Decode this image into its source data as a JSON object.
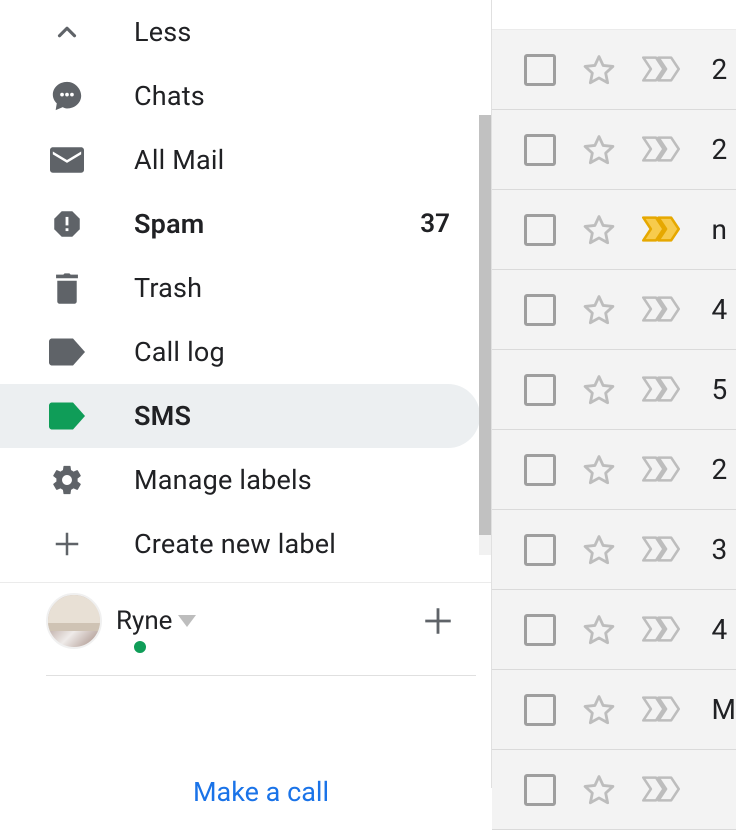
{
  "sidebar": {
    "items": [
      {
        "id": "less",
        "label": "Less",
        "icon": "chevron-up",
        "bold": false,
        "count": null
      },
      {
        "id": "chats",
        "label": "Chats",
        "icon": "chat",
        "bold": false,
        "count": null
      },
      {
        "id": "allmail",
        "label": "All Mail",
        "icon": "mail",
        "bold": false,
        "count": null
      },
      {
        "id": "spam",
        "label": "Spam",
        "icon": "spam",
        "bold": true,
        "count": "37"
      },
      {
        "id": "trash",
        "label": "Trash",
        "icon": "trash",
        "bold": false,
        "count": null
      },
      {
        "id": "calllog",
        "label": "Call log",
        "icon": "label-gray",
        "bold": false,
        "count": null
      },
      {
        "id": "sms",
        "label": "SMS",
        "icon": "label-green",
        "bold": true,
        "selected": true,
        "count": null
      },
      {
        "id": "manage",
        "label": "Manage labels",
        "icon": "gear",
        "bold": false,
        "count": null
      },
      {
        "id": "create",
        "label": "Create new label",
        "icon": "plus",
        "bold": false,
        "count": null
      }
    ]
  },
  "hangouts": {
    "user_name": "Ryne",
    "make_call": "Make a call"
  },
  "mail": {
    "rows": [
      {
        "sender": "2",
        "important": false
      },
      {
        "sender": "2",
        "important": false
      },
      {
        "sender": "n",
        "important": true
      },
      {
        "sender": "4",
        "important": false
      },
      {
        "sender": "5",
        "important": false
      },
      {
        "sender": "2",
        "important": false
      },
      {
        "sender": "3",
        "important": false
      },
      {
        "sender": "4",
        "important": false
      },
      {
        "sender": "M",
        "important": false
      },
      {
        "sender": "",
        "important": false
      }
    ]
  },
  "colors": {
    "icon_gray": "#5f6368",
    "label_green": "#0f9d58",
    "important_yellow": "#f7cb4d",
    "link_blue": "#1a73e8"
  }
}
